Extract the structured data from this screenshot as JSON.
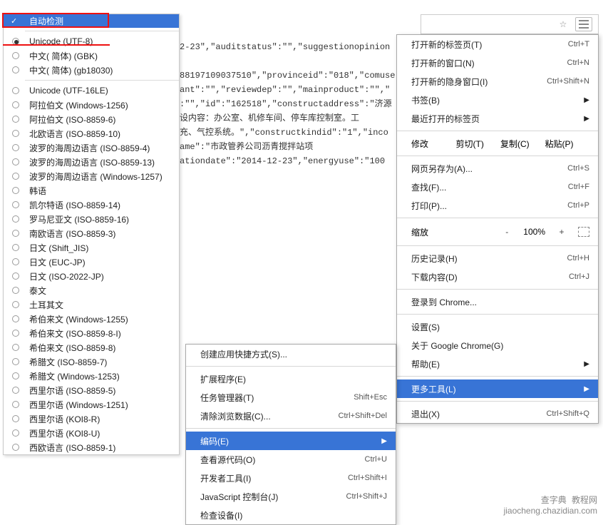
{
  "toolbar": {
    "star_icon": "star",
    "menu_icon": "menu"
  },
  "encoding_menu": {
    "auto_detect": "自动检测",
    "selected": "Unicode (UTF-8)",
    "items_group1": [
      "中文( 简体) (GBK)",
      "中文( 简体)  (gb18030)"
    ],
    "items_group2": [
      "Unicode (UTF-16LE)",
      "阿拉伯文 (Windows-1256)",
      "阿拉伯文 (ISO-8859-6)",
      "北欧语言 (ISO-8859-10)",
      "波罗的海周边语言 (ISO-8859-4)",
      "波罗的海周边语言 (ISO-8859-13)",
      "波罗的海周边语言 (Windows-1257)",
      "韩语",
      "凯尔特语 (ISO-8859-14)",
      "罗马尼亚文 (ISO-8859-16)",
      "南欧语言 (ISO-8859-3)",
      "日文 (Shift_JIS)",
      "日文 (EUC-JP)",
      "日文 (ISO-2022-JP)",
      "泰文",
      "土耳其文",
      "希伯来文 (Windows-1255)",
      "希伯来文 (ISO-8859-8-I)",
      "希伯来文 (ISO-8859-8)",
      "希腊文 (ISO-8859-7)",
      "希腊文 (Windows-1253)",
      "西里尔语 (ISO-8859-5)",
      "西里尔语 (Windows-1251)",
      "西里尔语 (KOI8-R)",
      "西里尔语 (KOI8-U)",
      "西欧语言 (ISO-8859-1)"
    ]
  },
  "page_json": "2-23\",\"auditstatus\":\"\",\"suggestionopinion\n\n88197109037510\",\"provinceid\":\"018\",\"comuse\nant\":\"\",\"reviewdep\":\"\",\"mainproduct\":\"\",\"\n:\"\",\"id\":\"162518\",\"constructaddress\":\"济源\n设内容：办公室、机修车间、停车库控制室。工\n充、气控系统。\",\"constructkindid\":\"1\",\"inco\name\":\"市政管养公司沥青搅拌站项\nationdate\":\"2014-12-23\",\"energyuse\":\"100",
  "main_menu": {
    "new_tab": {
      "label": "打开新的标签页(T)",
      "shortcut": "Ctrl+T"
    },
    "new_window": {
      "label": "打开新的窗口(N)",
      "shortcut": "Ctrl+N"
    },
    "new_incognito": {
      "label": "打开新的隐身窗口(I)",
      "shortcut": "Ctrl+Shift+N"
    },
    "bookmarks": {
      "label": "书签(B)"
    },
    "recent": {
      "label": "最近打开的标签页"
    },
    "edit": {
      "label": "修改",
      "cut": "剪切(T)",
      "copy": "复制(C)",
      "paste": "粘贴(P)"
    },
    "save_as": {
      "label": "网页另存为(A)...",
      "shortcut": "Ctrl+S"
    },
    "find": {
      "label": "查找(F)...",
      "shortcut": "Ctrl+F"
    },
    "print": {
      "label": "打印(P)...",
      "shortcut": "Ctrl+P"
    },
    "zoom": {
      "label": "缩放",
      "minus": "-",
      "value": "100%",
      "plus": "+"
    },
    "history": {
      "label": "历史记录(H)",
      "shortcut": "Ctrl+H"
    },
    "downloads": {
      "label": "下载内容(D)",
      "shortcut": "Ctrl+J"
    },
    "signin": {
      "label": "登录到 Chrome..."
    },
    "settings": {
      "label": "设置(S)"
    },
    "about": {
      "label": "关于 Google Chrome(G)"
    },
    "help": {
      "label": "帮助(E)"
    },
    "more_tools": {
      "label": "更多工具(L)"
    },
    "exit": {
      "label": "退出(X)",
      "shortcut": "Ctrl+Shift+Q"
    }
  },
  "tools_sub": {
    "create_shortcut": {
      "label": "创建应用快捷方式(S)..."
    },
    "extensions": {
      "label": "扩展程序(E)"
    },
    "task_manager": {
      "label": "任务管理器(T)",
      "shortcut": "Shift+Esc"
    },
    "clear_data": {
      "label": "清除浏览数据(C)...",
      "shortcut": "Ctrl+Shift+Del"
    },
    "encoding": {
      "label": "编码(E)"
    },
    "view_source": {
      "label": "查看源代码(O)",
      "shortcut": "Ctrl+U"
    },
    "dev_tools": {
      "label": "开发者工具(I)",
      "shortcut": "Ctrl+Shift+I"
    },
    "js_console": {
      "label": "JavaScript 控制台(J)",
      "shortcut": "Ctrl+Shift+J"
    },
    "inspect": {
      "label": "检查设备(I)"
    }
  },
  "watermark": {
    "line1": "查字典",
    "line2": "jiaocheng.chazidian.com"
  }
}
